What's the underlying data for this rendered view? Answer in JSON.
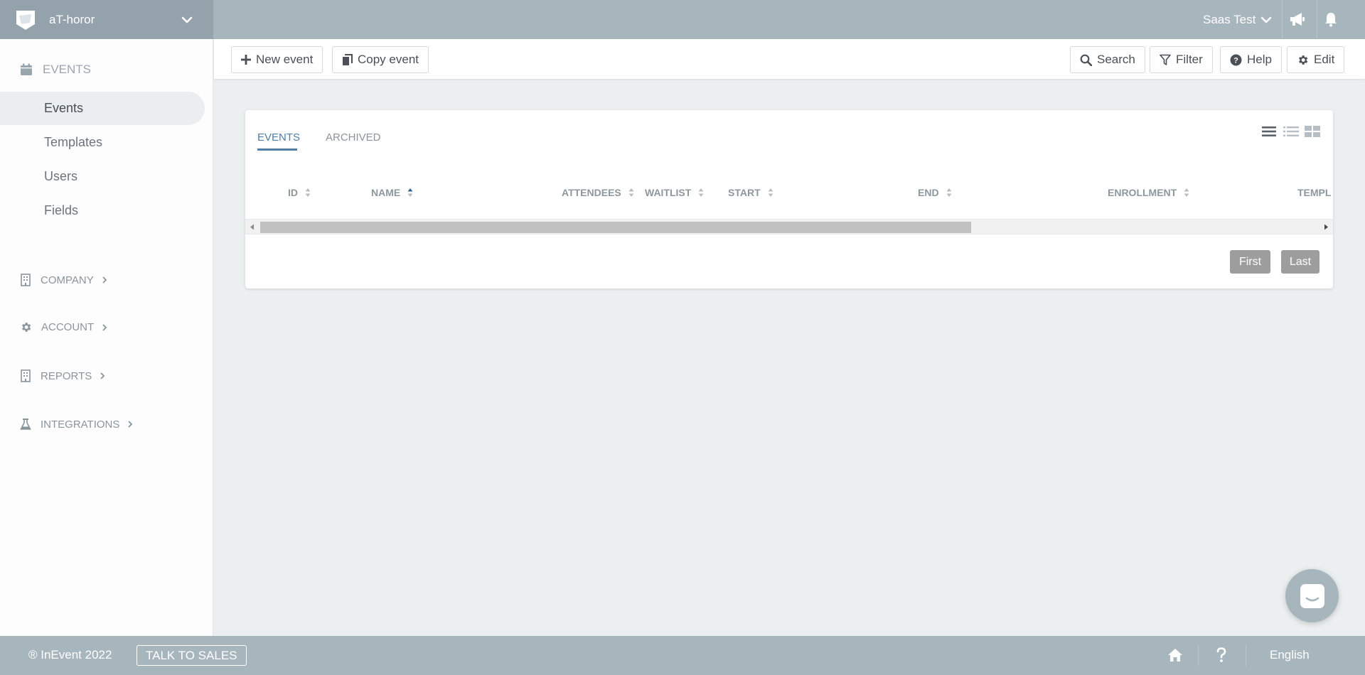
{
  "header": {
    "company_name": "aT-horor",
    "user_name": "Saas Test"
  },
  "sidebar": {
    "section_title": "EVENTS",
    "items": [
      {
        "label": "Events",
        "active": true
      },
      {
        "label": "Templates"
      },
      {
        "label": "Users"
      },
      {
        "label": "Fields"
      }
    ],
    "groups": [
      {
        "label": "COMPANY",
        "icon": "building-icon"
      },
      {
        "label": "ACCOUNT",
        "icon": "gear-icon"
      },
      {
        "label": "REPORTS",
        "icon": "building-icon"
      },
      {
        "label": "INTEGRATIONS",
        "icon": "flask-icon"
      }
    ]
  },
  "toolbar": {
    "new_event": "New event",
    "copy_event": "Copy event",
    "search": "Search",
    "filter": "Filter",
    "help": "Help",
    "edit": "Edit"
  },
  "tabs": [
    {
      "label": "EVENTS",
      "active": true
    },
    {
      "label": "ARCHIVED"
    }
  ],
  "table": {
    "columns": [
      "ID",
      "NAME",
      "ATTENDEES",
      "WAITLIST",
      "START",
      "END",
      "ENROLLMENT",
      "TEMPL"
    ],
    "sorted_column": "NAME",
    "rows": []
  },
  "pagination": {
    "first": "First",
    "last": "Last"
  },
  "footer": {
    "copyright": "® InEvent 2022",
    "talk_to_sales": "TALK TO SALES",
    "language": "English"
  },
  "colors": {
    "topbar": "#a7b5bd",
    "brand_bg": "#93a2ab",
    "accent": "#4f7ea8"
  }
}
